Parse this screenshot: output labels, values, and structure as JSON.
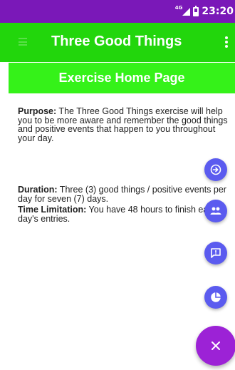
{
  "status_bar": {
    "network": "4G",
    "time": "23:20"
  },
  "app_bar": {
    "title": "Three Good Things",
    "menu_icon": "hamburger-icon",
    "overflow_icon": "more-vert-icon"
  },
  "page_header": {
    "title": "Exercise Home Page"
  },
  "content": {
    "purpose_label": "Purpose:",
    "purpose_text": " The Three Good Things exercise will help you to be more aware and remember the good things and positive events that happen to you throughout your day.",
    "duration_label": "Duration:",
    "duration_text": " Three (3) good things / positive events per day for seven (7) days.",
    "time_label": "Time Limitation:",
    "time_text": " You have 48 hours to finish each day's entries."
  },
  "fab_actions": [
    {
      "icon": "arrow-circle-right-icon"
    },
    {
      "icon": "people-icon"
    },
    {
      "icon": "feedback-icon"
    },
    {
      "icon": "pie-chart-icon"
    }
  ],
  "fab_main": {
    "icon": "close-icon"
  },
  "colors": {
    "status_bar": "#7a18b8",
    "app_bar": "#22d60c",
    "page_header": "#35f219",
    "fab_mini": "#5b5bef",
    "fab_main": "#9c22d6"
  }
}
